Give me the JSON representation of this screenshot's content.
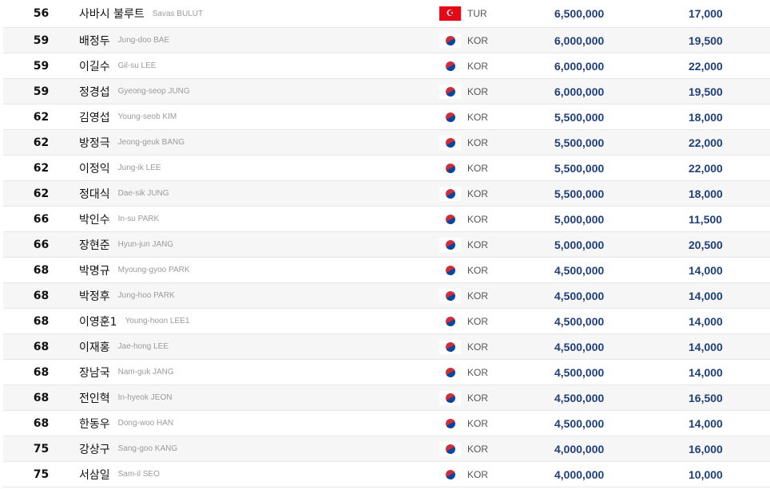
{
  "colors": {
    "value_text": "#1f3f7a",
    "row_alt": "#f6f6f6",
    "border": "#e6e6e6"
  },
  "rows": [
    {
      "rank": "56",
      "kname": "사바시 불루트",
      "ename": "Savas BULUT",
      "flag": "tur-flag-icon",
      "nat": "TUR",
      "prize": "6,500,000",
      "points": "17,000"
    },
    {
      "rank": "59",
      "kname": "배정두",
      "ename": "Jung-doo BAE",
      "flag": "kor-flag-icon",
      "nat": "KOR",
      "prize": "6,000,000",
      "points": "19,500"
    },
    {
      "rank": "59",
      "kname": "이길수",
      "ename": "Gil-su LEE",
      "flag": "kor-flag-icon",
      "nat": "KOR",
      "prize": "6,000,000",
      "points": "22,000"
    },
    {
      "rank": "59",
      "kname": "정경섭",
      "ename": "Gyeong-seop JUNG",
      "flag": "kor-flag-icon",
      "nat": "KOR",
      "prize": "6,000,000",
      "points": "19,500"
    },
    {
      "rank": "62",
      "kname": "김영섭",
      "ename": "Young-seob KIM",
      "flag": "kor-flag-icon",
      "nat": "KOR",
      "prize": "5,500,000",
      "points": "18,000"
    },
    {
      "rank": "62",
      "kname": "방정극",
      "ename": "Jeong-geuk BANG",
      "flag": "kor-flag-icon",
      "nat": "KOR",
      "prize": "5,500,000",
      "points": "22,000"
    },
    {
      "rank": "62",
      "kname": "이정익",
      "ename": "Jung-ik LEE",
      "flag": "kor-flag-icon",
      "nat": "KOR",
      "prize": "5,500,000",
      "points": "22,000"
    },
    {
      "rank": "62",
      "kname": "정대식",
      "ename": "Dae-sik JUNG",
      "flag": "kor-flag-icon",
      "nat": "KOR",
      "prize": "5,500,000",
      "points": "18,000"
    },
    {
      "rank": "66",
      "kname": "박인수",
      "ename": "In-su PARK",
      "flag": "kor-flag-icon",
      "nat": "KOR",
      "prize": "5,000,000",
      "points": "11,500"
    },
    {
      "rank": "66",
      "kname": "장현준",
      "ename": "Hyun-jun JANG",
      "flag": "kor-flag-icon",
      "nat": "KOR",
      "prize": "5,000,000",
      "points": "20,500"
    },
    {
      "rank": "68",
      "kname": "박명규",
      "ename": "Myoung-gyoo PARK",
      "flag": "kor-flag-icon",
      "nat": "KOR",
      "prize": "4,500,000",
      "points": "14,000"
    },
    {
      "rank": "68",
      "kname": "박정후",
      "ename": "Jung-hoo PARK",
      "flag": "kor-flag-icon",
      "nat": "KOR",
      "prize": "4,500,000",
      "points": "14,000"
    },
    {
      "rank": "68",
      "kname": "이영훈1",
      "ename": "Young-hoon LEE1",
      "flag": "kor-flag-icon",
      "nat": "KOR",
      "prize": "4,500,000",
      "points": "14,000"
    },
    {
      "rank": "68",
      "kname": "이재홍",
      "ename": "Jae-hong LEE",
      "flag": "kor-flag-icon",
      "nat": "KOR",
      "prize": "4,500,000",
      "points": "14,000"
    },
    {
      "rank": "68",
      "kname": "장남국",
      "ename": "Nam-guk JANG",
      "flag": "kor-flag-icon",
      "nat": "KOR",
      "prize": "4,500,000",
      "points": "14,000"
    },
    {
      "rank": "68",
      "kname": "전인혁",
      "ename": "In-hyeok JEON",
      "flag": "kor-flag-icon",
      "nat": "KOR",
      "prize": "4,500,000",
      "points": "16,500"
    },
    {
      "rank": "68",
      "kname": "한동우",
      "ename": "Dong-woo HAN",
      "flag": "kor-flag-icon",
      "nat": "KOR",
      "prize": "4,500,000",
      "points": "14,000"
    },
    {
      "rank": "75",
      "kname": "강상구",
      "ename": "Sang-goo KANG",
      "flag": "kor-flag-icon",
      "nat": "KOR",
      "prize": "4,000,000",
      "points": "16,000"
    },
    {
      "rank": "75",
      "kname": "서삼일",
      "ename": "Sam-il SEO",
      "flag": "kor-flag-icon",
      "nat": "KOR",
      "prize": "4,000,000",
      "points": "10,000"
    }
  ]
}
